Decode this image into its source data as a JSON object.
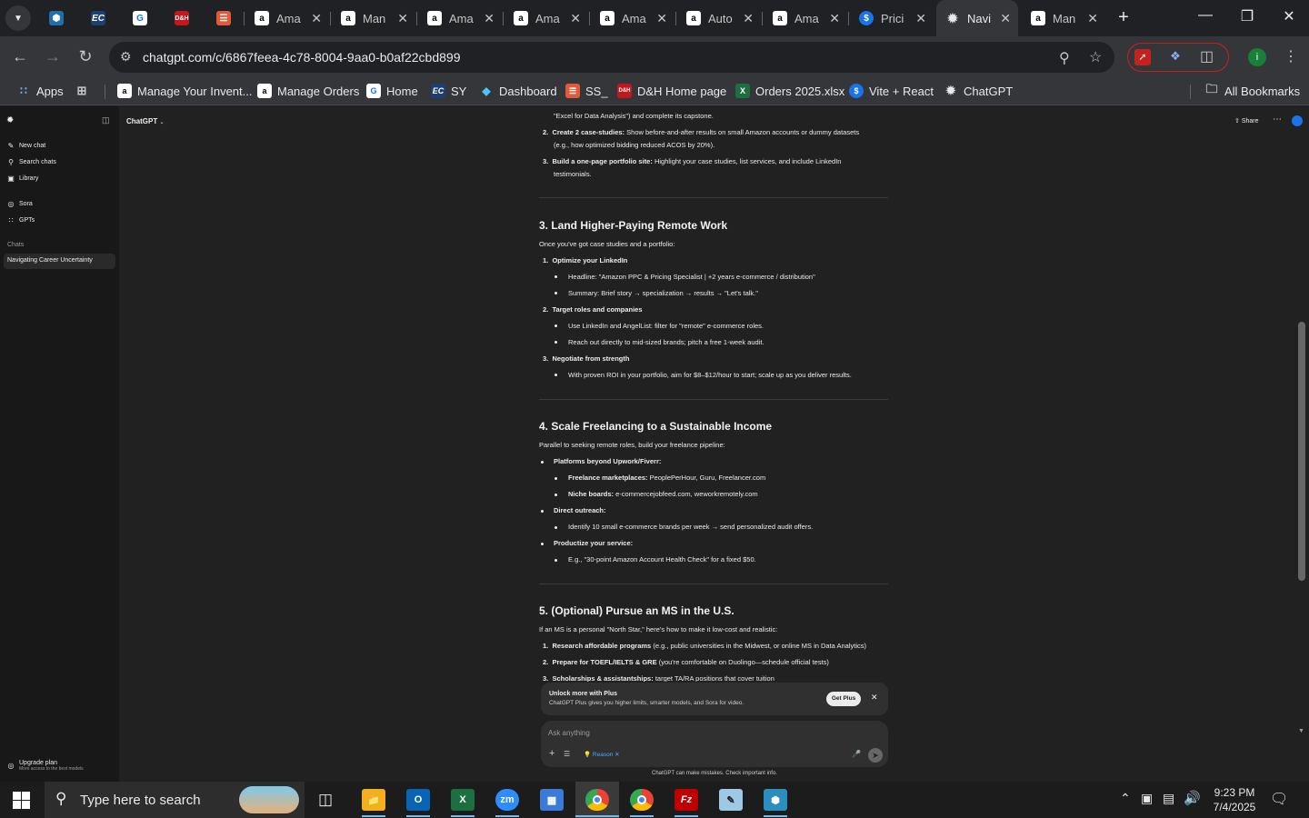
{
  "browser": {
    "tabs": [
      {
        "label": "",
        "icon": "hex-icon",
        "color": "#4aa3d6"
      },
      {
        "label": "",
        "icon": "ec-icon",
        "color": "#2b6cb0"
      },
      {
        "label": "",
        "icon": "page-icon",
        "color": "#4285f4"
      },
      {
        "label": "",
        "icon": "dh-icon",
        "color": "#c4161c"
      },
      {
        "label": "",
        "icon": "ss-icon",
        "color": "#d9534f"
      },
      {
        "label": "Ama",
        "icon": "amazon-icon"
      },
      {
        "label": "Man",
        "icon": "amazon-icon"
      },
      {
        "label": "Ama",
        "icon": "amazon-icon"
      },
      {
        "label": "Ama",
        "icon": "amazon-icon"
      },
      {
        "label": "Ama",
        "icon": "amazon-icon"
      },
      {
        "label": "Auto",
        "icon": "amazon-icon"
      },
      {
        "label": "Ama",
        "icon": "amazon-icon"
      },
      {
        "label": "Prici",
        "icon": "dollar-icon"
      },
      {
        "label": "Navi",
        "icon": "chatgpt-icon",
        "active": true
      },
      {
        "label": "Man",
        "icon": "amazon-icon"
      }
    ],
    "url": "chatgpt.com/c/6867feea-4c78-8004-9aa0-b0af22cbd899",
    "bookmarks": [
      {
        "label": "Apps"
      },
      {
        "label": "Manage Your Invent..."
      },
      {
        "label": "Manage Orders"
      },
      {
        "label": "Home"
      },
      {
        "label": "SY"
      },
      {
        "label": "Dashboard"
      },
      {
        "label": "SS_"
      },
      {
        "label": "D&H Home page"
      },
      {
        "label": "Orders 2025.xlsx"
      },
      {
        "label": "Vite + React"
      },
      {
        "label": "ChatGPT"
      }
    ],
    "all_bookmarks": "All Bookmarks",
    "profile_initial": "i"
  },
  "sidebar": {
    "new_chat": "New chat",
    "search_chats": "Search chats",
    "library": "Library",
    "sora": "Sora",
    "gpts": "GPTs",
    "chats_heading": "Chats",
    "active_chat": "Navigating Career Uncertainty",
    "upgrade_title": "Upgrade plan",
    "upgrade_sub": "More access to the best models"
  },
  "header": {
    "model": "ChatGPT",
    "share": "Share"
  },
  "content": {
    "intro_tail": "\"Excel for Data Analysis\") and complete its capstone.",
    "s2_items": [
      {
        "num": "2.",
        "bold": "Create 2 case-studies:",
        "text": " Show before-and-after results on small Amazon accounts or dummy datasets",
        "cont": "(e.g., how optimized bidding reduced ACOS by 20%)."
      },
      {
        "num": "3.",
        "bold": "Build a one-page portfolio site:",
        "text": " Highlight your case studies, list services, and include LinkedIn",
        "cont": "testimonials."
      }
    ],
    "s3_heading": "3. Land Higher-Paying Remote Work",
    "s3_intro": "Once you've got case studies and a portfolio:",
    "s3_n1": "Optimize your LinkedIn",
    "s3_n1_b1": "Headline: \"Amazon PPC & Pricing Specialist | +2 years e-commerce / distribution\"",
    "s3_n1_b2": "Summary: Brief story → specialization → results → \"Let's talk.\"",
    "s3_n2": "Target roles and companies",
    "s3_n2_b1": "Use LinkedIn and AngelList: filter for \"remote\" e-commerce roles.",
    "s3_n2_b2": "Reach out directly to mid-sized brands; pitch a free 1-week audit.",
    "s3_n3": "Negotiate from strength",
    "s3_n3_b1": "With proven ROI in your portfolio, aim for $8–$12/hour to start; scale up as you deliver results.",
    "s4_heading": "4. Scale Freelancing to a Sustainable Income",
    "s4_intro": "Parallel to seeking remote roles, build your freelance pipeline:",
    "s4_b1": "Platforms beyond Upwork/Fiverr:",
    "s4_b1_s1_bold": "Freelance marketplaces:",
    "s4_b1_s1_text": " PeoplePerHour, Guru, Freelancer.com",
    "s4_b1_s2_bold": "Niche boards:",
    "s4_b1_s2_text": " e-commercejobfeed.com, weworkremotely.com",
    "s4_b2": "Direct outreach:",
    "s4_b2_s1": "Identify 10 small e-commerce brands per week → send personalized audit offers.",
    "s4_b3": "Productize your service:",
    "s4_b3_s1": "E.g., \"30-point Amazon Account Health Check\" for a fixed $50.",
    "s5_heading": "5. (Optional) Pursue an MS in the U.S.",
    "s5_intro": "If an MS is a personal \"North Star,\" here's how to make it low-cost and realistic:",
    "s5_n1_bold": "Research affordable programs",
    "s5_n1_text": " (e.g., public universities in the Midwest, or online MS in Data Analytics)",
    "s5_n2_bold": "Prepare for TOEFL/IELTS & GRE",
    "s5_n2_text": " (you're comfortable on Duolingo—schedule official tests)",
    "s5_n3_bold": "Scholarships & assistantships:",
    "s5_n3_text": " target TA/RA positions that cover tuition"
  },
  "plus_banner": {
    "title": "Unlock more with Plus",
    "subtitle": "ChatGPT Plus gives you higher limits, smarter models, and Sora for video.",
    "button": "Get Plus"
  },
  "composer": {
    "placeholder": "Ask anything",
    "reason_chip": "Reason"
  },
  "footer_note": "ChatGPT can make mistakes. Check important info.",
  "taskbar": {
    "search_placeholder": "Type here to search",
    "time": "9:23 PM",
    "date": "7/4/2025"
  }
}
